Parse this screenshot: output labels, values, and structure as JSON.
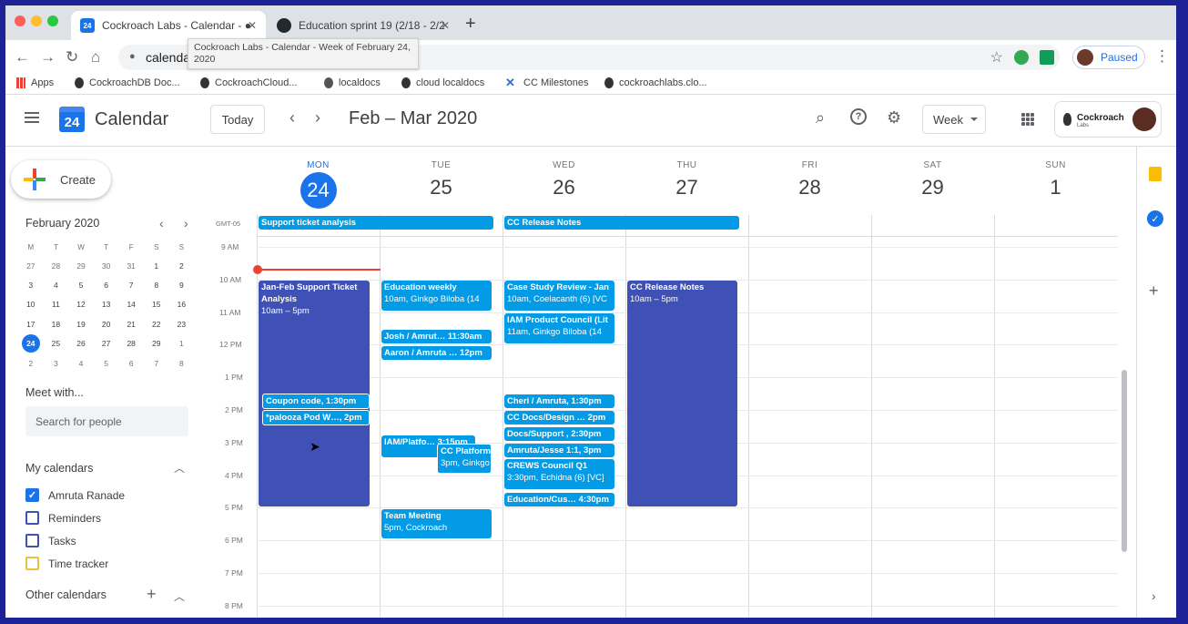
{
  "browser": {
    "tabs": [
      {
        "title": "Cockroach Labs - Calendar - ●",
        "favicon": "calendar-icon",
        "active": true
      },
      {
        "title": "Education sprint 19 (2/18 - 2/2",
        "favicon": "github-icon",
        "active": false
      }
    ],
    "url": "calenda",
    "tooltip": "Cockroach Labs - Calendar - Week of February 24, 2020",
    "profile_status": "Paused",
    "bookmarks": [
      "Apps",
      "CockroachDB Doc...",
      "CockroachCloud...",
      "localdocs",
      "cloud localdocs",
      "CC Milestones",
      "cockroachlabs.clo..."
    ]
  },
  "header": {
    "app_title": "Calendar",
    "logo_day": "24",
    "today_label": "Today",
    "date_range": "Feb – Mar 2020",
    "view_label": "Week",
    "org_name": "Cockroach",
    "org_sub": "Labs"
  },
  "sidebar": {
    "create_label": "Create",
    "minical": {
      "title": "February 2020",
      "dow": [
        "M",
        "T",
        "W",
        "T",
        "F",
        "S",
        "S"
      ],
      "weeks": [
        [
          "27",
          "28",
          "29",
          "30",
          "31",
          "1",
          "2"
        ],
        [
          "3",
          "4",
          "5",
          "6",
          "7",
          "8",
          "9"
        ],
        [
          "10",
          "11",
          "12",
          "13",
          "14",
          "15",
          "16"
        ],
        [
          "17",
          "18",
          "19",
          "20",
          "21",
          "22",
          "23"
        ],
        [
          "24",
          "25",
          "26",
          "27",
          "28",
          "29",
          "1"
        ],
        [
          "2",
          "3",
          "4",
          "5",
          "6",
          "7",
          "8"
        ]
      ]
    },
    "meet_with": "Meet with...",
    "search_placeholder": "Search for people",
    "my_calendars_label": "My calendars",
    "my_calendars": [
      {
        "name": "Amruta Ranade",
        "checked": true,
        "color": "#1a73e8"
      },
      {
        "name": "Reminders",
        "checked": false,
        "color": "#3f51b5"
      },
      {
        "name": "Tasks",
        "checked": false,
        "color": "#3f51b5"
      },
      {
        "name": "Time tracker",
        "checked": false,
        "color": "#e4c441"
      }
    ],
    "other_calendars_label": "Other calendars"
  },
  "week": {
    "timezone": "GMT-05",
    "days": [
      {
        "dow": "MON",
        "num": "24",
        "today": true
      },
      {
        "dow": "TUE",
        "num": "25",
        "today": false
      },
      {
        "dow": "WED",
        "num": "26",
        "today": false
      },
      {
        "dow": "THU",
        "num": "27",
        "today": false
      },
      {
        "dow": "FRI",
        "num": "28",
        "today": false
      },
      {
        "dow": "SAT",
        "num": "29",
        "today": false
      },
      {
        "dow": "SUN",
        "num": "1",
        "today": false
      }
    ],
    "times": [
      "9 AM",
      "10 AM",
      "11 AM",
      "12 PM",
      "1 PM",
      "2 PM",
      "3 PM",
      "4 PM",
      "5 PM",
      "6 PM",
      "7 PM",
      "8 PM"
    ],
    "allday_events": [
      {
        "title": "Support ticket analysis"
      },
      {
        "title": "CC Release Notes"
      }
    ],
    "events": {
      "mon_long": {
        "title": "Jan-Feb Support Ticket Analysis",
        "sub": "10am – 5pm"
      },
      "mon_coupon": {
        "title": "Coupon code, 1:30pm"
      },
      "mon_palooza": {
        "title": "*palooza Pod W…, 2pm"
      },
      "tue_edu": {
        "title": "Education weekly",
        "sub": "10am, Ginkgo Biloba (14"
      },
      "tue_josh": {
        "title": "Josh / Amrut… 11:30am"
      },
      "tue_aaron": {
        "title": "Aaron / Amruta … 12pm"
      },
      "tue_iam": {
        "title": "IAM/Platfo… 3:15pm"
      },
      "tue_ccplat": {
        "title": "CC Platform",
        "sub": "3pm, Ginkgo"
      },
      "tue_team": {
        "title": "Team Meeting",
        "sub": "5pm, Cockroach"
      },
      "wed_case": {
        "title": "Case Study Review - Jan",
        "sub": "10am, Coelacanth (6) [VC"
      },
      "wed_iam": {
        "title": "IAM Product Council (Lit",
        "sub": "11am, Ginkgo Biloba (14"
      },
      "wed_cheri": {
        "title": "Cheri / Amruta, 1:30pm"
      },
      "wed_ccdocs": {
        "title": "CC Docs/Design … 2pm"
      },
      "wed_docs": {
        "title": "Docs/Support , 2:30pm"
      },
      "wed_amruta": {
        "title": "Amruta/Jesse 1:1, 3pm"
      },
      "wed_crews": {
        "title": "CREWS Council Q1",
        "sub": "3:30pm, Echidna (6) [VC]"
      },
      "wed_edu": {
        "title": "Education/Cus… 4:30pm"
      },
      "thu_cc": {
        "title": "CC Release Notes",
        "sub": "10am – 5pm"
      }
    }
  }
}
